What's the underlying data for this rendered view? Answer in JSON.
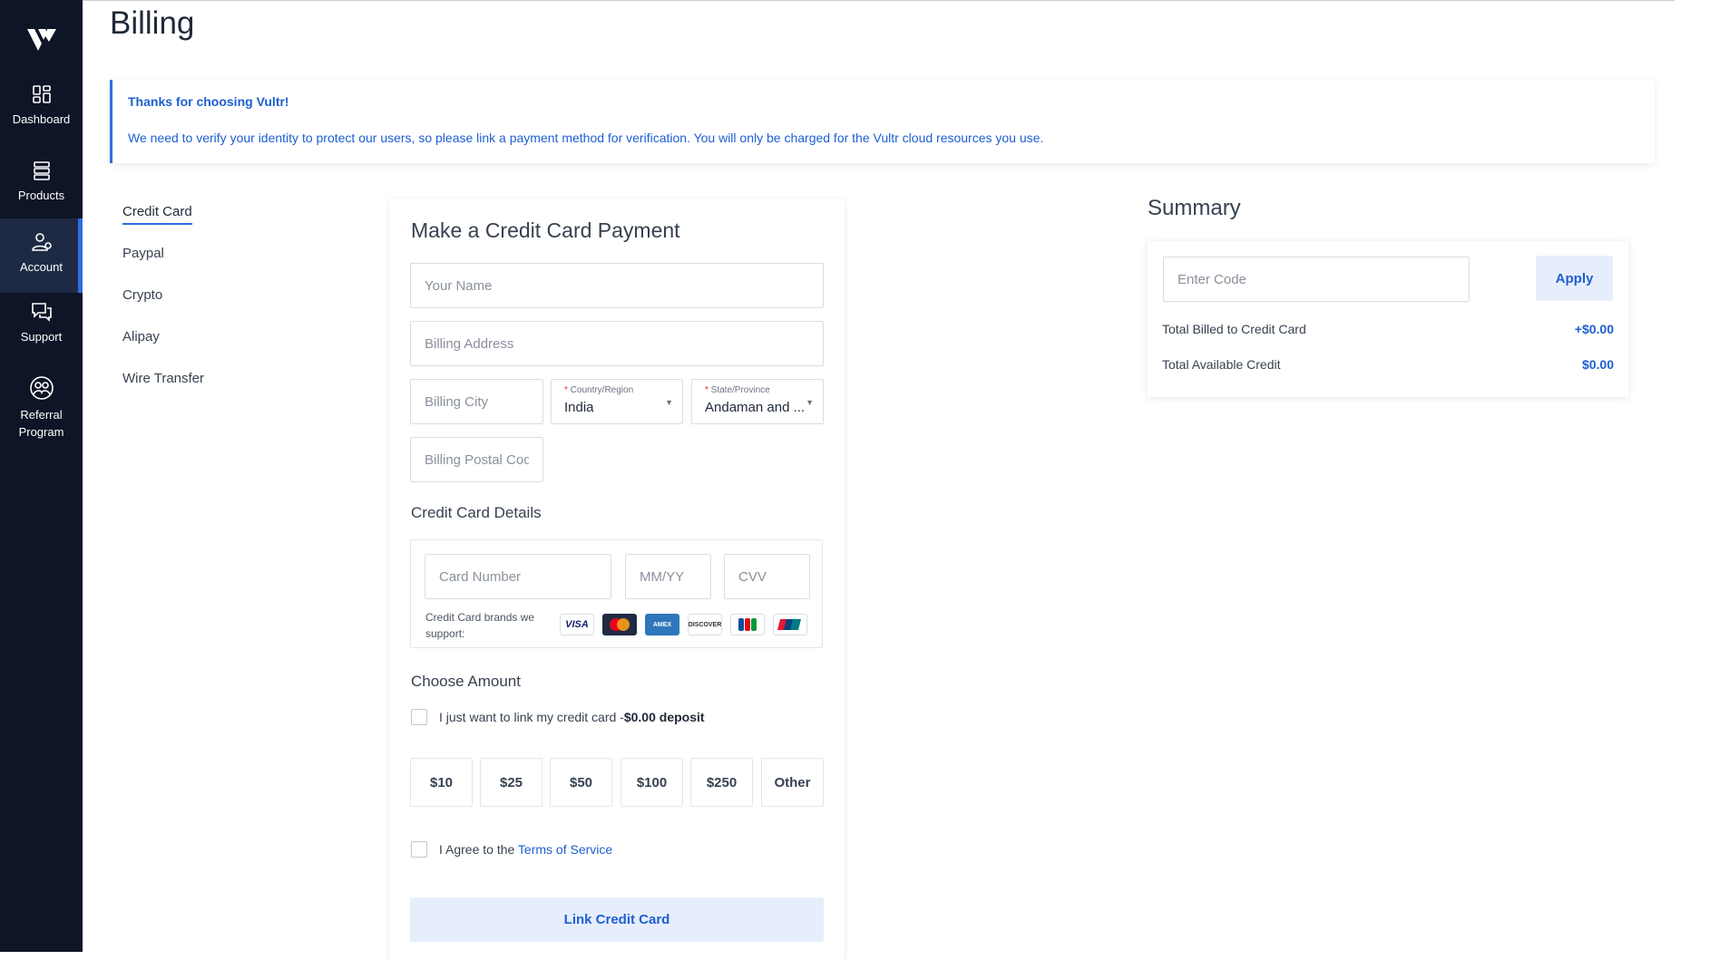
{
  "sidebar": {
    "items": [
      {
        "label": "Dashboard",
        "icon": "dashboard-icon"
      },
      {
        "label": "Products",
        "icon": "products-icon"
      },
      {
        "label": "Account",
        "icon": "account-icon"
      },
      {
        "label": "Support",
        "icon": "support-icon"
      },
      {
        "label": "Referral Program",
        "icon": "referral-icon"
      }
    ],
    "active": "Account"
  },
  "header": {
    "title": "Billing"
  },
  "notice": {
    "title": "Thanks for choosing Vultr!",
    "body": "We need to verify your identity to protect our users, so please link a payment method for verification. You will only be charged for the Vultr cloud resources you use."
  },
  "payment_methods": {
    "items": [
      "Credit Card",
      "Paypal",
      "Crypto",
      "Alipay",
      "Wire Transfer"
    ],
    "active": "Credit Card"
  },
  "form": {
    "title": "Make a Credit Card Payment",
    "name_placeholder": "Your Name",
    "address_placeholder": "Billing Address",
    "city_placeholder": "Billing City",
    "country": {
      "label": "Country/Region",
      "value": "India"
    },
    "state": {
      "label": "State/Province",
      "value": "Andaman and ..."
    },
    "postal_placeholder": "Billing Postal Cod",
    "cc_section": "Credit Card Details",
    "card_number_placeholder": "Card Number",
    "expiry_placeholder": "MM/YY",
    "cvv_placeholder": "CVV",
    "brands_text": "Credit Card brands we support:",
    "brands": [
      "VISA",
      "MASTERCARD",
      "AMEX",
      "DISCOVER",
      "JCB",
      "UNIONPAY"
    ],
    "amount_section": "Choose Amount",
    "link_only_text": "I just want to link my credit card -",
    "link_only_bold": "$0.00 deposit",
    "amounts": [
      "$10",
      "$25",
      "$50",
      "$100",
      "$250",
      "Other"
    ],
    "agree_text": "I Agree to the ",
    "terms_link": "Terms of Service",
    "submit": "Link Credit Card"
  },
  "summary": {
    "title": "Summary",
    "code_placeholder": "Enter Code",
    "apply": "Apply",
    "rows": [
      {
        "label": "Total Billed to Credit Card",
        "value": "+$0.00"
      },
      {
        "label": "Total Available Credit",
        "value": "$0.00"
      }
    ]
  },
  "colors": {
    "sidebar_bg": "#0d1526",
    "accent": "#2f6fe0",
    "link": "#1d5fd1",
    "button_bg": "#e7eefb"
  }
}
